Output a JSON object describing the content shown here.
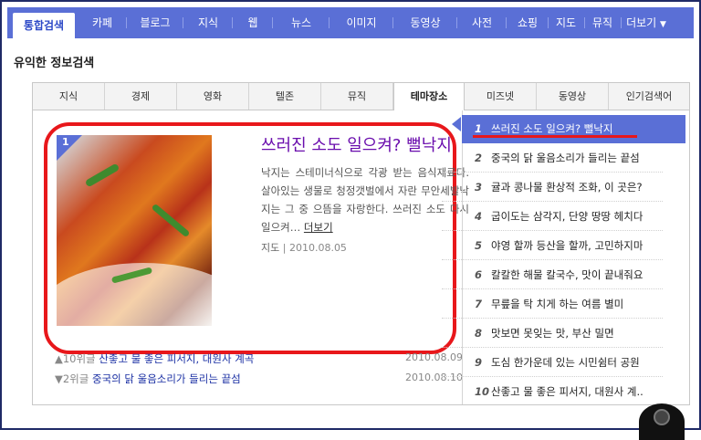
{
  "topnav": {
    "items": [
      "통합검색",
      "카페",
      "블로그",
      "지식",
      "웹",
      "뉴스",
      "이미지",
      "동영상",
      "사전",
      "쇼핑",
      "지도",
      "뮤직",
      "더보기"
    ],
    "more_arrow": "chevron-down-icon"
  },
  "section_title": "유익한 정보검색",
  "tabs": [
    "지식",
    "경제",
    "영화",
    "텔존",
    "뮤직",
    "테마장소",
    "미즈넷",
    "동영상",
    "인기검색어"
  ],
  "active_tab": "테마장소",
  "feature": {
    "badge": "1",
    "title": "쓰러진 소도 일으켜? 뻘낙지",
    "description": "낙지는 스테미너식으로 각광 받는 음식재료다. 살아있는 생물로 청정갯벌에서 자란 무안세발낙지는 그 중 으뜸을 자랑한다. 쓰러진 소도 다시 일으켜…",
    "more": "더보기",
    "source": "지도",
    "date": "2010.08.05"
  },
  "sub_items": [
    {
      "rank": "▲10위글",
      "title": "산좋고 물 좋은 피서지, 대원사 계곡",
      "date": "2010.08.09"
    },
    {
      "rank": "▼2위글",
      "title": "중국의 닭 울음소리가 들리는 끝섬",
      "date": "2010.08.10"
    }
  ],
  "ranking": [
    {
      "num": "1",
      "title": "쓰러진 소도 일으켜? 뻘낙지"
    },
    {
      "num": "2",
      "title": "중국의 닭 울음소리가 들리는 끝섬"
    },
    {
      "num": "3",
      "title": "귤과 콩나물 환상적 조화, 이 곳은?"
    },
    {
      "num": "4",
      "title": "굽이도는 삼각지, 단양 땅땅 헤치다"
    },
    {
      "num": "5",
      "title": "야영 할까 등산을 할까, 고민하지마"
    },
    {
      "num": "6",
      "title": "칼칼한 해물 칼국수, 맛이 끝내줘요"
    },
    {
      "num": "7",
      "title": "무릎을 탁 치게 하는 여름 별미"
    },
    {
      "num": "8",
      "title": "맛보면 못잊는 맛, 부산 밀면"
    },
    {
      "num": "9",
      "title": "도심 한가운데 있는 시민쉼터 공원"
    },
    {
      "num": "10",
      "title": "산좋고 물 좋은 피서지, 대원사 계.."
    }
  ],
  "colors": {
    "nav": "#5a6fd6",
    "highlight": "#e8171b",
    "title": "#6a0dad"
  }
}
